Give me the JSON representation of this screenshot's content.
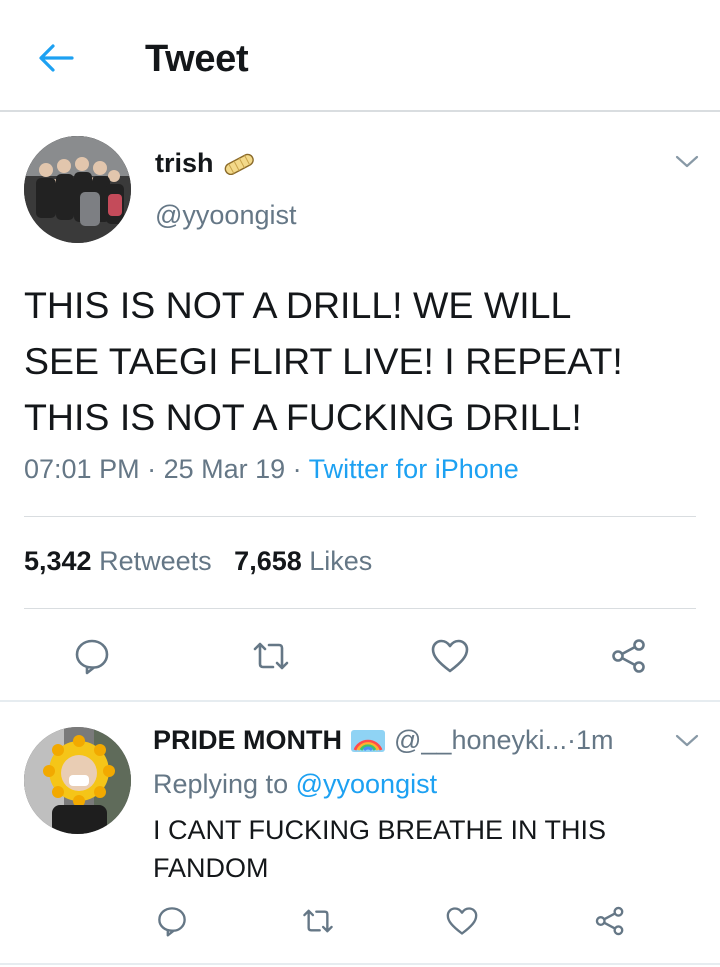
{
  "header": {
    "title": "Tweet",
    "back_icon": "arrow-left-icon"
  },
  "tweet": {
    "author_name": "trish",
    "author_emoji": "burrito-emoji",
    "author_handle": "@yyoongist",
    "lines": [
      "THIS IS NOT A DRILL! WE WILL",
      "SEE TAEGI FLIRT LIVE! I REPEAT!",
      "THIS IS NOT A FUCKING DRILL!"
    ],
    "time": "07:01 PM",
    "date": "25 Mar 19",
    "separator": " · ",
    "source": "Twitter for iPhone",
    "retweets_count": "5,342",
    "retweets_label": "Retweets",
    "likes_count": "7,658",
    "likes_label": "Likes"
  },
  "reply": {
    "name": "PRIDE MONTH",
    "name_emoji": "rainbow-emoji",
    "handle": "@__honeyki...",
    "separator": " · ",
    "time": "1m",
    "replying_label": "Replying to",
    "replying_to": "@yyoongist",
    "lines": [
      "I CANT FUCKING BREATHE IN THIS",
      "FANDOM"
    ]
  },
  "colors": {
    "accent": "#1da1f2",
    "secondary_text": "#657786",
    "primary_text": "#14171a",
    "divider": "#d9dde0"
  },
  "icons": {
    "reply": "reply-icon",
    "retweet": "retweet-icon",
    "like": "heart-icon",
    "share": "share-icon",
    "menu": "chevron-down-icon"
  }
}
